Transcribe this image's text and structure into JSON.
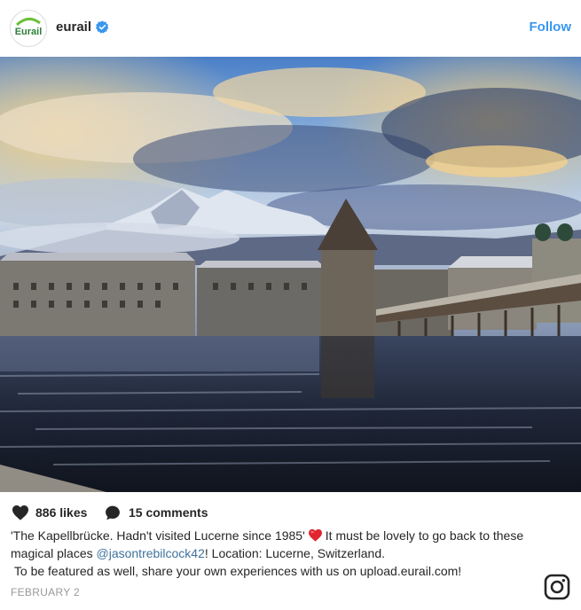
{
  "account": {
    "username": "eurail",
    "avatar_text": "Eurail",
    "verified_icon": "verified-badge-icon",
    "follow_label": "Follow"
  },
  "photo": {
    "subject": "post-photo"
  },
  "stats": {
    "likes": "886 likes",
    "comments": "15 comments"
  },
  "caption": {
    "part1": "'The Kapellbrücke. Hadn't visited Lucerne since 1985'",
    "emoji": "heart-emoji",
    "part2": "It must be lovely to go back to these magical places",
    "mention": "@jasontrebilcock42",
    "part3": "! Location: Lucerne, Switzerland.",
    "line3": "To be featured as well, share your own experiences with us on upload.eurail.com!"
  },
  "date": "FEBRUARY 2",
  "colors": {
    "follow": "#3897f0",
    "mention": "#3f729b",
    "emoji_heart": "#e0262f",
    "brand_green": "#2e9e3a"
  }
}
